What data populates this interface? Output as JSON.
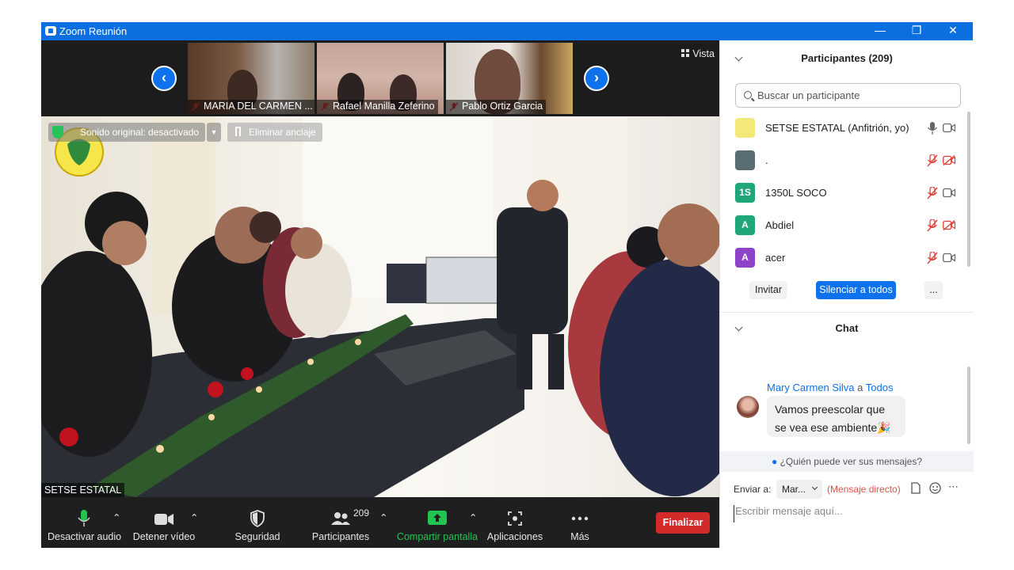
{
  "window": {
    "title": "Zoom Reunión"
  },
  "strip": {
    "thumbnails": [
      {
        "name": "MARIA DEL CARMEN ..."
      },
      {
        "name": "Rafael Manilla Zeferino"
      },
      {
        "name": "Pablo Ortiz Garcia"
      }
    ],
    "view_label": "Vista"
  },
  "main_video": {
    "original_sound_label": "Sonido original: desactivado",
    "unpin_label": "Eliminar anclaje",
    "speaker_name": "SETSE ESTATAL"
  },
  "toolbar": {
    "mute_label": "Desactivar audio",
    "video_label": "Detener vídeo",
    "security_label": "Seguridad",
    "participants_label": "Participantes",
    "participants_count": "209",
    "share_label": "Compartir pantalla",
    "apps_label": "Aplicaciones",
    "more_label": "Más",
    "end_label": "Finalizar"
  },
  "participants_panel": {
    "title": "Participantes (209)",
    "search_placeholder": "Buscar un participante",
    "items": [
      {
        "name": "SETSE ESTATAL (Anfitrión, yo)",
        "avatar": "",
        "avatar_color": "#f4e87a",
        "mic": "on",
        "cam": "off"
      },
      {
        "name": ".",
        "avatar": "",
        "avatar_color": "#5a6d73",
        "mic": "muted",
        "cam": "muted"
      },
      {
        "name": "1350L SOCO",
        "avatar": "1S",
        "avatar_color": "#1fa67a",
        "mic": "muted",
        "cam": "off"
      },
      {
        "name": "Abdiel",
        "avatar": "A",
        "avatar_color": "#1fa67a",
        "mic": "muted",
        "cam": "muted"
      },
      {
        "name": "acer",
        "avatar": "A",
        "avatar_color": "#8e44c9",
        "mic": "muted",
        "cam": "off"
      }
    ],
    "invite_label": "Invitar",
    "mute_all_label": "Silenciar a todos",
    "more_label": "..."
  },
  "chat": {
    "title": "Chat",
    "message": {
      "sender": "Mary Carmen Silva",
      "to_word": "a",
      "recipient": "Todos",
      "text": "Vamos preescolar que se vea ese ambiente"
    },
    "who_can_see": "¿Quién puede ver sus mensajes?",
    "send_to_label": "Enviar a:",
    "recipient_select": "Mar...",
    "direct_label": "(Mensaje directo)",
    "input_placeholder": "Escribir mensaje aquí..."
  },
  "colors": {
    "accent": "#0e72ed",
    "end": "#d32a2a",
    "share": "#23c552",
    "muted": "#e0403a"
  }
}
